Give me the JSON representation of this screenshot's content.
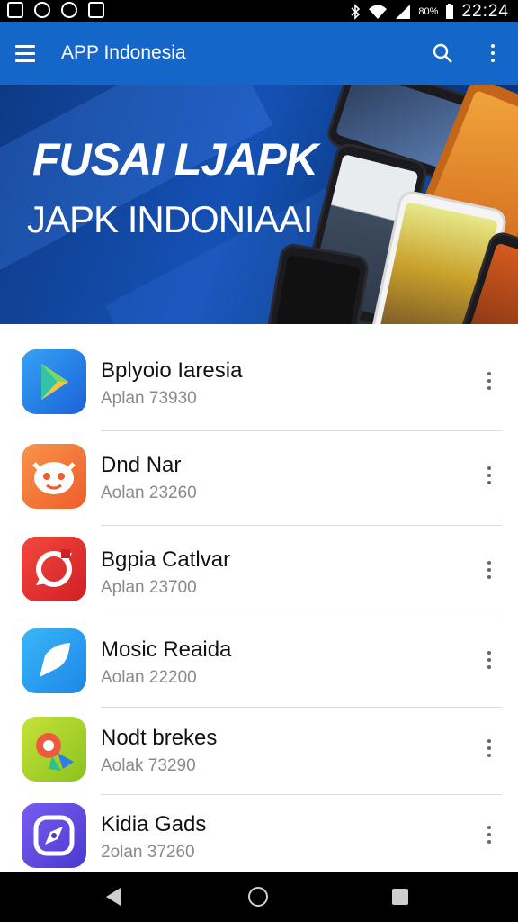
{
  "status_bar": {
    "battery": "80%",
    "time": "22:24",
    "icons": [
      "gallery-icon",
      "sync-icon",
      "camera-icon",
      "image-icon",
      "bluetooth-icon",
      "wifi-icon",
      "signal-icon",
      "battery-icon"
    ]
  },
  "app_bar": {
    "title": "APP Indonesia",
    "icons": [
      "menu-icon",
      "search-icon",
      "more-vert-icon"
    ],
    "color": "#1467c9"
  },
  "banner": {
    "title": "FUSAI LJAPK",
    "subtitle": "JAPK INDONIAAI"
  },
  "apps": [
    {
      "name": "Bplyoio Iaresia",
      "meta": "Aplan 73930",
      "icon": "play-store-icon"
    },
    {
      "name": "Dnd Nar",
      "meta": "Aolan 23260",
      "icon": "cat-face-icon"
    },
    {
      "name": "Bgpia Catlvar",
      "meta": "Aplan 23700",
      "icon": "refresh-app-icon"
    },
    {
      "name": "Mosic Reaida",
      "meta": "Aolan 22200",
      "icon": "chat-bubble-icon"
    },
    {
      "name": "Nodt brekes",
      "meta": "Aolak 73290",
      "icon": "maps-pin-icon"
    },
    {
      "name": "Kidia Gads",
      "meta": "2olan 37260",
      "icon": "compass-icon"
    }
  ],
  "nav_bar": {
    "icons": [
      "back-icon",
      "home-icon",
      "recents-icon"
    ]
  }
}
